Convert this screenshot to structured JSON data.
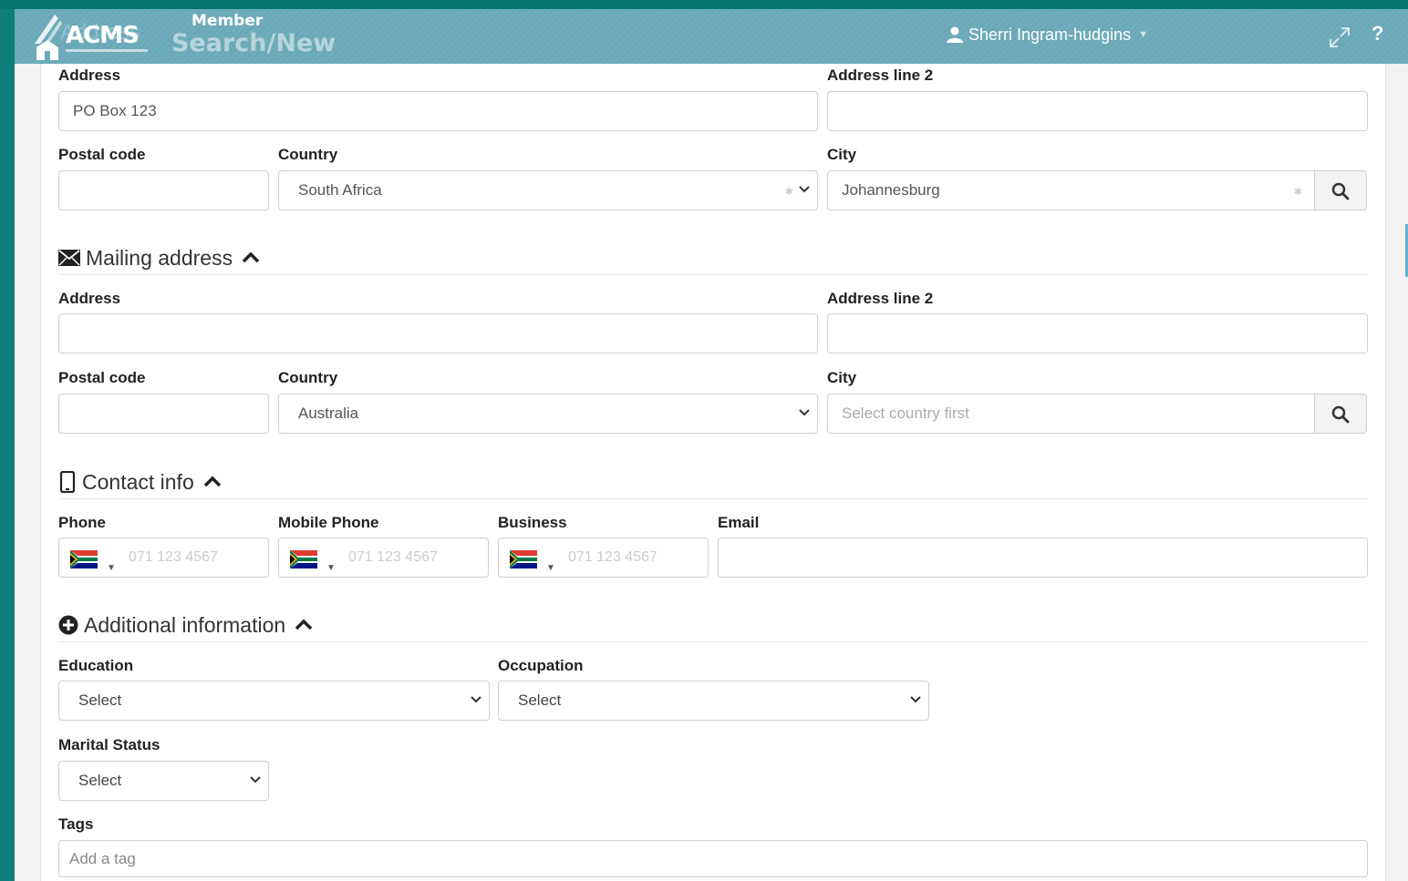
{
  "header": {
    "logo_text": "ACMS",
    "ghost_title": "Address",
    "module": "Member",
    "page": "Search/New",
    "user_name": "Sherri Ingram-hudgins",
    "help": "?"
  },
  "physical_address": {
    "address_label": "Address",
    "address_value": "PO Box 123",
    "address2_label": "Address line 2",
    "address2_value": "",
    "postal_label": "Postal code",
    "postal_value": "",
    "country_label": "Country",
    "country_value": "South Africa",
    "city_label": "City",
    "city_value": "Johannesburg"
  },
  "mailing_address": {
    "title": "Mailing address",
    "address_label": "Address",
    "address_value": "",
    "address2_label": "Address line 2",
    "address2_value": "",
    "postal_label": "Postal code",
    "postal_value": "",
    "country_label": "Country",
    "country_value": "Australia",
    "city_label": "City",
    "city_placeholder": "Select country first"
  },
  "contact_info": {
    "title": "Contact info",
    "phone_label": "Phone",
    "mobile_label": "Mobile Phone",
    "business_label": "Business",
    "email_label": "Email",
    "phone_placeholder": "071 123 4567",
    "email_value": ""
  },
  "additional_info": {
    "title": "Additional information",
    "education_label": "Education",
    "education_value": "Select",
    "occupation_label": "Occupation",
    "occupation_value": "Select",
    "marital_label": "Marital Status",
    "marital_value": "Select",
    "tags_label": "Tags",
    "tags_placeholder": "Add a tag"
  },
  "colors": {
    "page_bg": "#0e7e79",
    "header_bg": "#6aa9b8",
    "panel_bg": "#ffffff"
  },
  "icons": [
    "user-icon",
    "expand-icon",
    "envelope-icon",
    "mobile-phone-icon",
    "plus-circle-icon",
    "chevron-up-icon",
    "chevron-down-icon",
    "search-icon",
    "south-africa-flag-icon"
  ]
}
